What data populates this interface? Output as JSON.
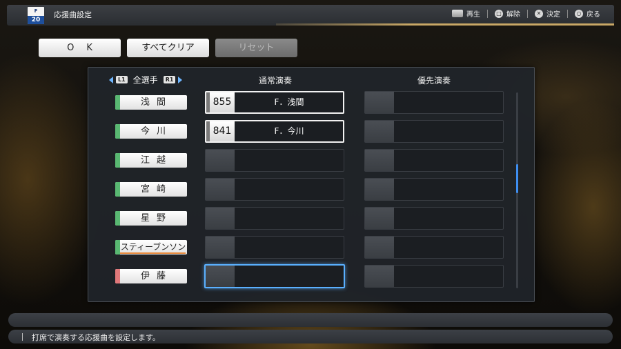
{
  "header": {
    "team_logo_mark": "F",
    "team_number": "20",
    "title": "応援曲設定",
    "controls": [
      {
        "icon": "touchpad-icon",
        "label": "再生"
      },
      {
        "icon": "square-button-icon",
        "glyph": "□",
        "label": "解除"
      },
      {
        "icon": "cross-button-icon",
        "glyph": "✕",
        "label": "決定"
      },
      {
        "icon": "circle-button-icon",
        "glyph": "○",
        "label": "戻る"
      }
    ]
  },
  "actions": {
    "ok": "OK",
    "clear_all": "すべてクリア",
    "reset": "リセット"
  },
  "panel": {
    "l1": "L1",
    "r1": "R1",
    "player_filter": "全選手",
    "normal_header": "通常演奏",
    "priority_header": "優先演奏"
  },
  "players": [
    {
      "name": "浅間",
      "normal_number": "855",
      "normal_song": "F．浅間"
    },
    {
      "name": "今川",
      "normal_number": "841",
      "normal_song": "F．今川"
    },
    {
      "name": "江越"
    },
    {
      "name": "宮崎"
    },
    {
      "name": "星野"
    },
    {
      "name": "スティーブンソン"
    },
    {
      "name": "伊藤"
    }
  ],
  "help": {
    "text": "打席で演奏する応援曲を設定します。"
  },
  "colors": {
    "accent_gold": "#c9a866",
    "focus_blue": "#5ab0ff",
    "stripe_green": "#59b872",
    "stripe_red": "#e0787a"
  }
}
